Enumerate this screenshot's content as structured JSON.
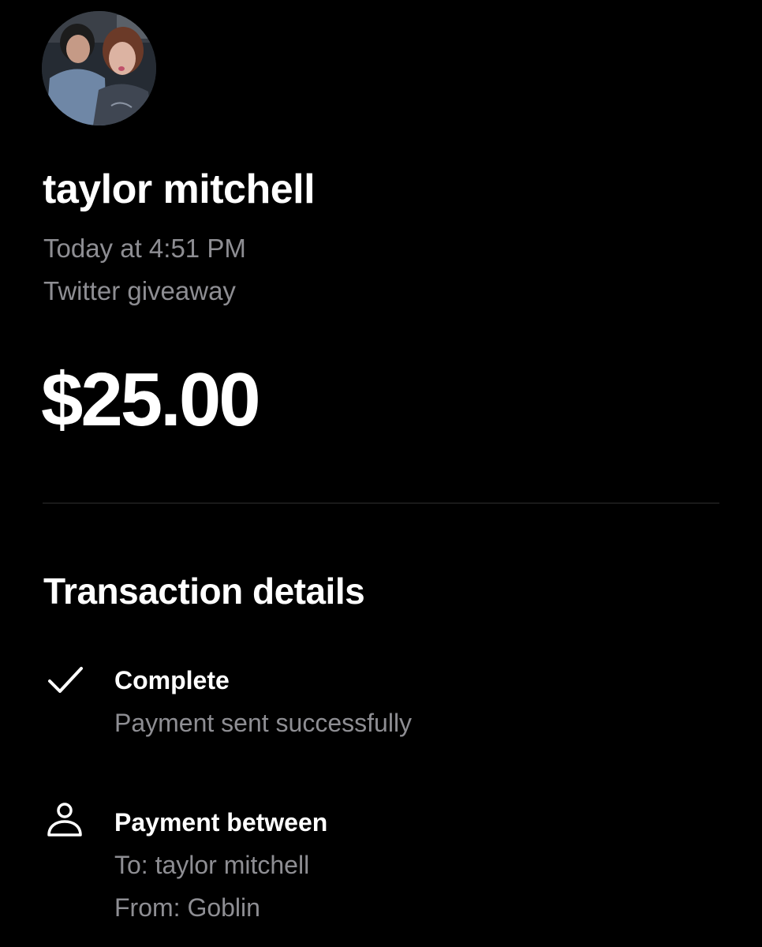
{
  "profile": {
    "avatar_icon": "profile-photo",
    "name": "taylor mitchell",
    "time": "Today at 4:51 PM",
    "note": "Twitter giveaway"
  },
  "amount": "$25.00",
  "details": {
    "title": "Transaction details",
    "status": {
      "icon": "checkmark-icon",
      "title": "Complete",
      "subtitle": "Payment sent successfully"
    },
    "parties": {
      "icon": "person-icon",
      "title": "Payment between",
      "to": "To: taylor mitchell",
      "from": "From: Goblin"
    }
  },
  "colors": {
    "background": "#000000",
    "primary_text": "#ffffff",
    "secondary_text": "#8e8e93",
    "divider": "#2f2f2f"
  }
}
